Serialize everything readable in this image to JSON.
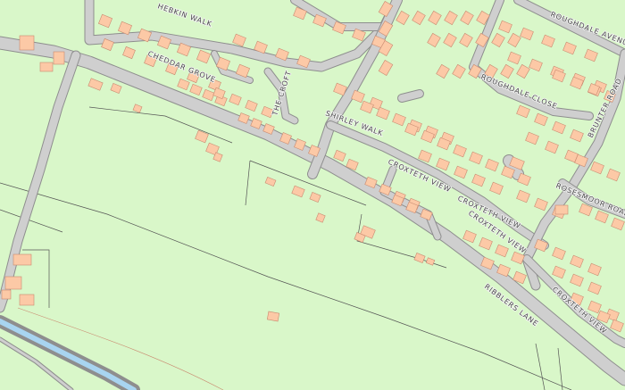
{
  "map": {
    "colors": {
      "land": "#d9f7c9",
      "road_fill": "#cfcfcf",
      "road_edge": "#8e8e8e",
      "building": "#fcc9a6",
      "building_edge": "#c98a70",
      "water": "#a8d4f0",
      "boundary": "#555555"
    },
    "streets": {
      "hebkin_walk": "HEBKIN WALK",
      "roughdale_avenue": "ROUGHDALE AVENUE",
      "cheddar_grove": "CHEDDAR GROVE",
      "the_croft": "THE CROFT",
      "roughdale_close": "ROUGHDALE CLOSE",
      "brunter_road": "BRUNTER ROAD",
      "shirley_walk": "SHIRLEY WALK",
      "croxteth_view_1": "CROXTETH VIEW",
      "croxteth_view_2": "CROXTETH VIEW",
      "croxteth_view_3": "CROXTETH VIEW",
      "croxteth_view_4": "CROXTETH VIEW",
      "rosesmoor_road": "ROSESMOOR ROAD",
      "ribblers_lane": "RIBBLERS LANE"
    }
  }
}
